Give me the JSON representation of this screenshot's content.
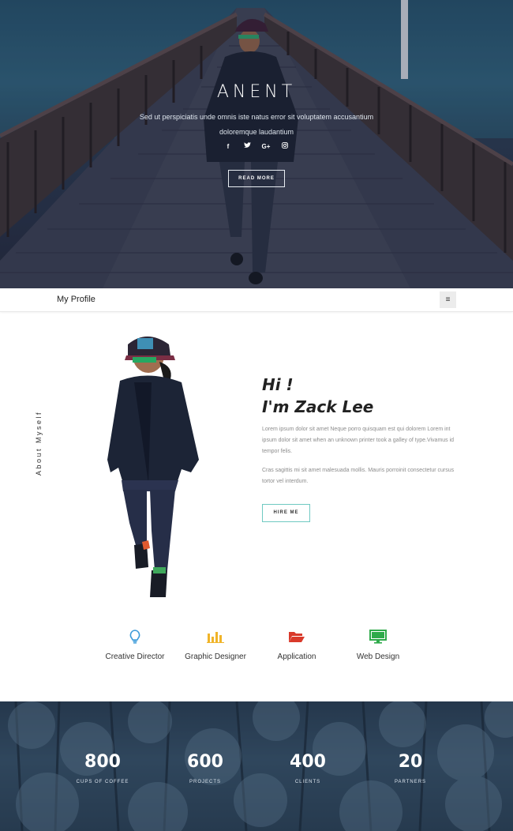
{
  "hero": {
    "title": "ANENT",
    "text": "Sed ut perspiciatis unde omnis iste natus error sit voluptatem accusantium doloremque laudantium",
    "social": [
      {
        "icon": "facebook-icon",
        "glyph": "f"
      },
      {
        "icon": "twitter-icon",
        "glyph": "t"
      },
      {
        "icon": "google-plus-icon",
        "glyph": "G+"
      },
      {
        "icon": "instagram-icon",
        "glyph": "◎"
      }
    ],
    "button_label": "READ MORE"
  },
  "navbar": {
    "brand": "My Profile",
    "menu_icon": "hamburger-icon",
    "menu_glyph": "≡"
  },
  "about": {
    "side_label": "About Myself",
    "greeting_line1": "Hi !",
    "greeting_line2": "I'm Zack Lee",
    "paragraph1": "Lorem ipsum dolor sit amet Neque porro quisquam est qui dolorem Lorem int ipsum dolor sit amet when an unknown printer took a galley of type.Vivamus id tempor felis.",
    "paragraph2": "Cras sagittis mi sit amet malesuada mollis. Mauris porroinit consectetur cursus tortor vel interdum.",
    "button_label": "HIRE ME"
  },
  "services": [
    {
      "label": "Creative Director",
      "icon": "lightbulb-icon",
      "color": "#3a9ad9"
    },
    {
      "label": "Graphic Designer",
      "icon": "bar-chart-icon",
      "color": "#f0b429"
    },
    {
      "label": "Application",
      "icon": "folder-open-icon",
      "color": "#d93a2b"
    },
    {
      "label": "Web Design",
      "icon": "monitor-icon",
      "color": "#2eaa4a"
    }
  ],
  "stats": [
    {
      "value": "800",
      "caption": "CUPS OF COFFEE"
    },
    {
      "value": "600",
      "caption": "PROJECTS"
    },
    {
      "value": "400",
      "caption": "CLIENTS"
    },
    {
      "value": "20",
      "caption": "PARTNERS"
    }
  ],
  "colors": {
    "accent_teal": "#6fc9c2",
    "hero_dark": "#283349"
  }
}
